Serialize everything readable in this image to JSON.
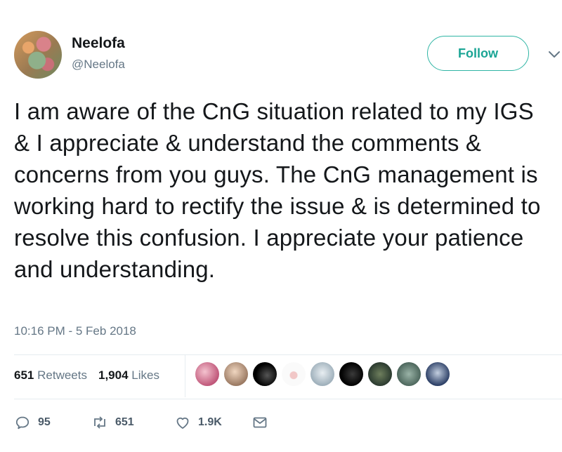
{
  "tweet": {
    "author_name": "Neelofa",
    "author_handle": "@Neelofa",
    "follow_label": "Follow",
    "text": "I am aware of the CnG situation related to my IGS & I appreciate & understand the comments & concerns from you guys. The CnG management is working hard to rectify the issue & is determined to resolve this confusion. I appreciate your patience and understanding.",
    "timestamp": "10:16 PM - 5 Feb 2018"
  },
  "stats": {
    "retweets_count": "651",
    "retweets_label": "Retweets",
    "likes_count": "1,904",
    "likes_label": "Likes"
  },
  "actions": {
    "reply_count": "95",
    "retweet_count": "651",
    "like_count": "1.9K"
  },
  "colors": {
    "accent": "#1ba595",
    "muted_text": "#657786",
    "divider": "#e6ecf0"
  },
  "icons": [
    "caret-down-icon",
    "reply-icon",
    "retweet-icon",
    "heart-icon",
    "direct-message-icon"
  ]
}
